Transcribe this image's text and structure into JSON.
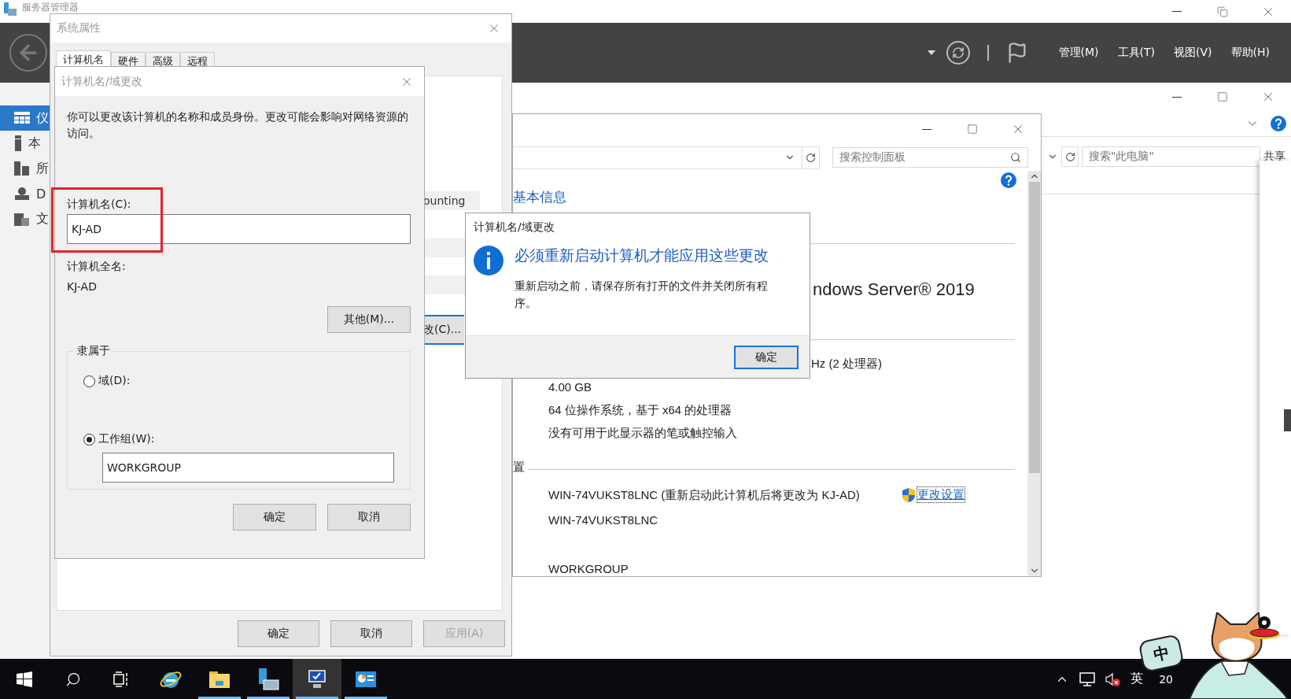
{
  "server_manager": {
    "title": "服务器管理器",
    "menus": [
      {
        "label": "管理(M)"
      },
      {
        "label": "工具(T)"
      },
      {
        "label": "视图(V)"
      },
      {
        "label": "帮助(H)"
      }
    ],
    "sidebar": [
      {
        "kind": "dashboard",
        "label": "仪",
        "selected": true
      },
      {
        "kind": "server",
        "label": "本",
        "selected": false
      },
      {
        "kind": "servers",
        "label": "所",
        "selected": false
      },
      {
        "kind": "dns",
        "label": "D",
        "selected": false
      },
      {
        "kind": "files",
        "label": "文",
        "selected": false
      }
    ]
  },
  "explorer": {
    "search": {
      "placeholder": "搜索\"此电脑\""
    },
    "toolbar_text": "共享"
  },
  "control_panel": {
    "search": {
      "placeholder": "搜索控制面板"
    },
    "heading": "基本信息",
    "edition": "ndows Server® 2019",
    "processor": "Hz  (2 处理器)",
    "specs": [
      "4.00 GB",
      "64 位操作系统，基于 x64 的处理器",
      "没有可用于此显示器的笔或触控输入"
    ],
    "section": "置",
    "computer_rows": [
      "WIN-74VUKST8LNC (重新启动此计算机后将更改为 KJ-AD)",
      "WIN-74VUKST8LNC",
      "WORKGROUP"
    ],
    "change_link": "更改设置"
  },
  "system_properties": {
    "title": "系统属性",
    "tabs": [
      {
        "label": "计算机名",
        "selected": true
      },
      {
        "label": "硬件",
        "selected": false
      },
      {
        "label": "高级",
        "selected": false
      },
      {
        "label": "远程",
        "selected": false
      }
    ],
    "behind_text": "ounting",
    "change_button": "改(C)...",
    "buttons": [
      {
        "label": "确定",
        "disabled": false
      },
      {
        "label": "取消",
        "disabled": false
      },
      {
        "label": "应用(A)",
        "disabled": true
      }
    ]
  },
  "name_dialog": {
    "title": "计算机名/域更改",
    "description": "你可以更改该计算机的名称和成员身份。更改可能会影响对网络资源的访问。",
    "name_label": "计算机名(C):",
    "name_value": "KJ-AD",
    "full_name_label": "计算机全名:",
    "full_name": "KJ-AD",
    "more_button": "其他(M)...",
    "member_of": {
      "legend": "隶属于",
      "options": [
        {
          "label": "域(D):",
          "selected": false
        },
        {
          "label": "工作组(W):",
          "selected": true
        }
      ],
      "workgroup_value": "WORKGROUP"
    },
    "buttons": [
      "确定",
      "取消"
    ]
  },
  "restart_dialog": {
    "title": "计算机名/域更改",
    "heading": "必须重新启动计算机才能应用这些更改",
    "body": "重新启动之前，请保存所有打开的文件并关闭所有程序。",
    "button": "确定"
  },
  "taskbar": {
    "apps": [
      {
        "kind": "ie",
        "running": false,
        "selected": false
      },
      {
        "kind": "folder",
        "running": true,
        "selected": false
      },
      {
        "kind": "server-manager",
        "running": true,
        "selected": false
      },
      {
        "kind": "system",
        "running": true,
        "selected": true
      },
      {
        "kind": "control-panel",
        "running": true,
        "selected": false
      }
    ],
    "input_language": "英",
    "clock": "20"
  },
  "ime_widget": {
    "label": "中"
  }
}
